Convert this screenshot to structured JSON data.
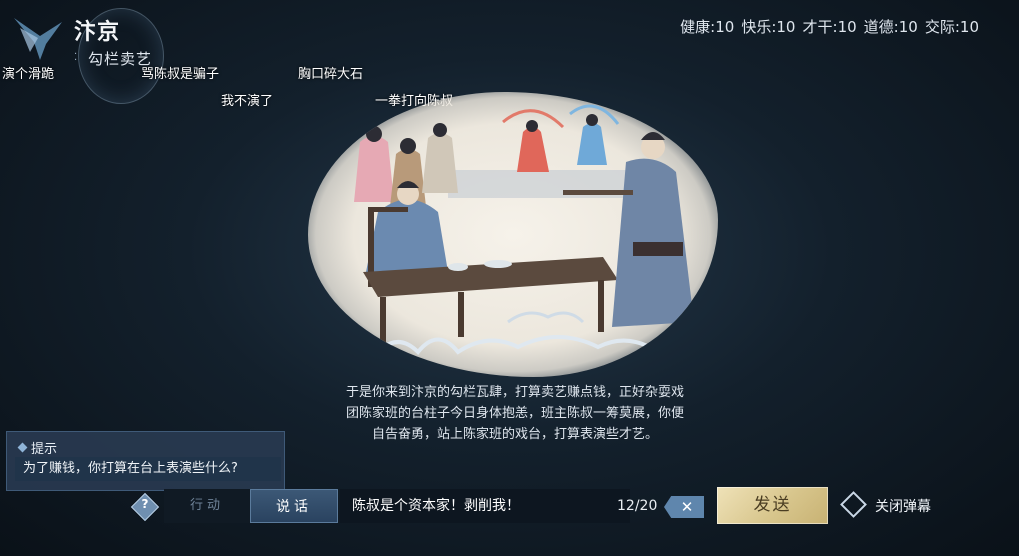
{
  "location": {
    "city": "汴京",
    "venue": "勾栏卖艺"
  },
  "stats": [
    {
      "label": "健康",
      "value": "10"
    },
    {
      "label": "快乐",
      "value": "10"
    },
    {
      "label": "才干",
      "value": "10"
    },
    {
      "label": "道德",
      "value": "10"
    },
    {
      "label": "交际",
      "value": "10"
    }
  ],
  "danmaku": [
    "演个滑跪",
    "骂陈叔是骗子",
    "胸口碎大石",
    "我不演了",
    "一拳打向陈叔"
  ],
  "story": [
    "于是你来到汴京的勾栏瓦肆，打算卖艺赚点钱，正好杂耍戏",
    "团陈家班的台柱子今日身体抱恙，班主陈叔一筹莫展，你便",
    "自告奋勇，站上陈家班的戏台，打算表演些才艺。"
  ],
  "hint": {
    "title": "提示",
    "text": "为了赚钱，你打算在台上表演些什么?"
  },
  "controls": {
    "help_label": "?",
    "tab_action": "行动",
    "tab_speak": "说话",
    "input_value": "陈叔是个资本家！剥削我！",
    "char_count": "12/20",
    "clear_label": "✕",
    "send_label": "发送",
    "close_danmaku_label": "关闭弹幕"
  },
  "colors": {
    "background": "#13202c",
    "send_button": "#d8c68d",
    "active_tab": "#3c5876",
    "hint_box": "#283a50"
  },
  "icons": {
    "logo": "bird-logo-icon",
    "help": "help-diamond-icon",
    "clear": "clear-x-icon",
    "close_danmaku": "diamond-outline-icon"
  }
}
